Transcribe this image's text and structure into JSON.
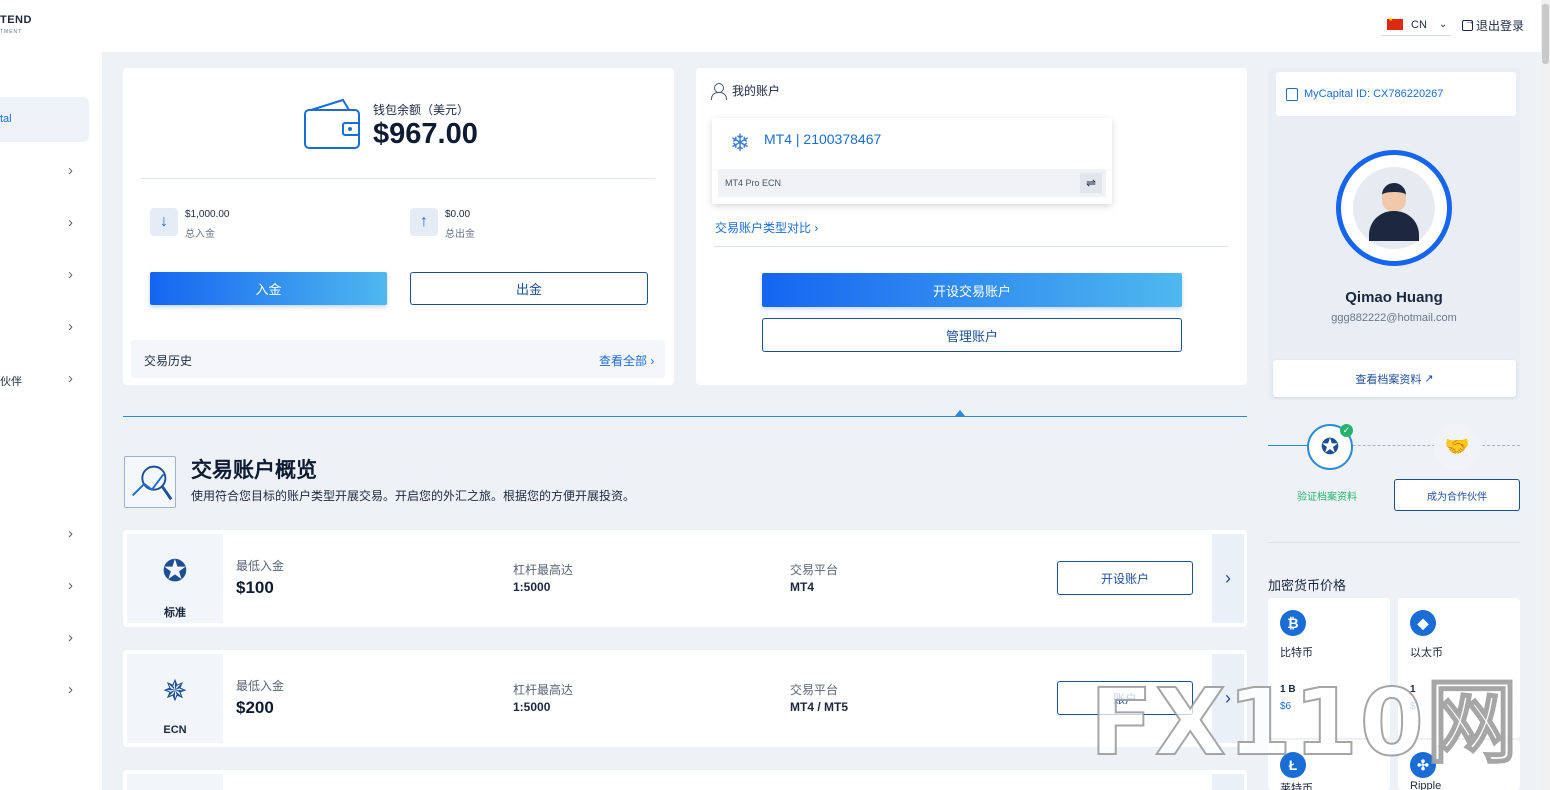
{
  "header": {
    "logo_line1": "TEND",
    "logo_line2": "TMENT",
    "lang_code": "CN",
    "logout_label": "退出登录"
  },
  "sidebar": {
    "active_label": "tal",
    "items": [
      {
        "label": ""
      },
      {
        "label": ""
      },
      {
        "label": ""
      },
      {
        "label": ""
      },
      {
        "label": "伙伴"
      },
      {
        "label": ""
      },
      {
        "label": ""
      },
      {
        "label": ""
      },
      {
        "label": ""
      }
    ]
  },
  "wallet": {
    "label": "钱包余额（美元）",
    "value": "$967.00",
    "deposit_total": "$1,000.00",
    "deposit_total_label": "总入金",
    "withdraw_total": "$0.00",
    "withdraw_total_label": "总出金",
    "deposit_button": "入金",
    "withdraw_button": "出金",
    "history_label": "交易历史",
    "view_all_label": "查看全部"
  },
  "accounts": {
    "title": "我的账户",
    "card_title": "MT4 | 2100378467",
    "card_type": "MT4 Pro ECN",
    "compare_link": "交易账户类型对比",
    "open_button": "开设交易账户",
    "manage_button": "管理账户"
  },
  "overview": {
    "title": "交易账户概览",
    "subtitle": "使用符合您目标的账户类型开展交易。开启您的外汇之旅。根据您的方便开展投资。",
    "min_deposit_label": "最低入金",
    "leverage_label": "杠杆最高达",
    "platform_label": "交易平台",
    "open_account_label": "开设账户",
    "rows": [
      {
        "name": "标准",
        "min_deposit": "$100",
        "leverage": "1:5000",
        "platform": "MT4",
        "open_label": "开设账户"
      },
      {
        "name": "ECN",
        "min_deposit": "$200",
        "leverage": "1:5000",
        "platform": "MT4 / MT5",
        "open_label": "账户"
      }
    ]
  },
  "profile": {
    "id_label": "MyCapital ID: CX786220267",
    "name": "Qimao Huang",
    "email": "ggg882222@hotmail.com",
    "view_profile_button": "查看档案资料",
    "step_verify_label": "验证档案资料",
    "step_partner_button": "成为合作伙伴"
  },
  "crypto": {
    "title": "加密货币价格",
    "coins": [
      {
        "name": "比特币",
        "icon": "bitcoin-icon",
        "unit": "1 B",
        "price": "$6",
        "color": "#1b6dd6"
      },
      {
        "name": "以太币",
        "icon": "ethereum-icon",
        "unit": "1",
        "price": "$",
        "color": "#1b6dd6"
      },
      {
        "name": "莱特币",
        "icon": "litecoin-icon",
        "unit": "",
        "price": "",
        "color": "#1b6dd6"
      },
      {
        "name": "Ripple",
        "icon": "ripple-icon",
        "unit": "",
        "price": "",
        "color": "#1b6dd6"
      }
    ]
  },
  "watermark": "FX110网"
}
